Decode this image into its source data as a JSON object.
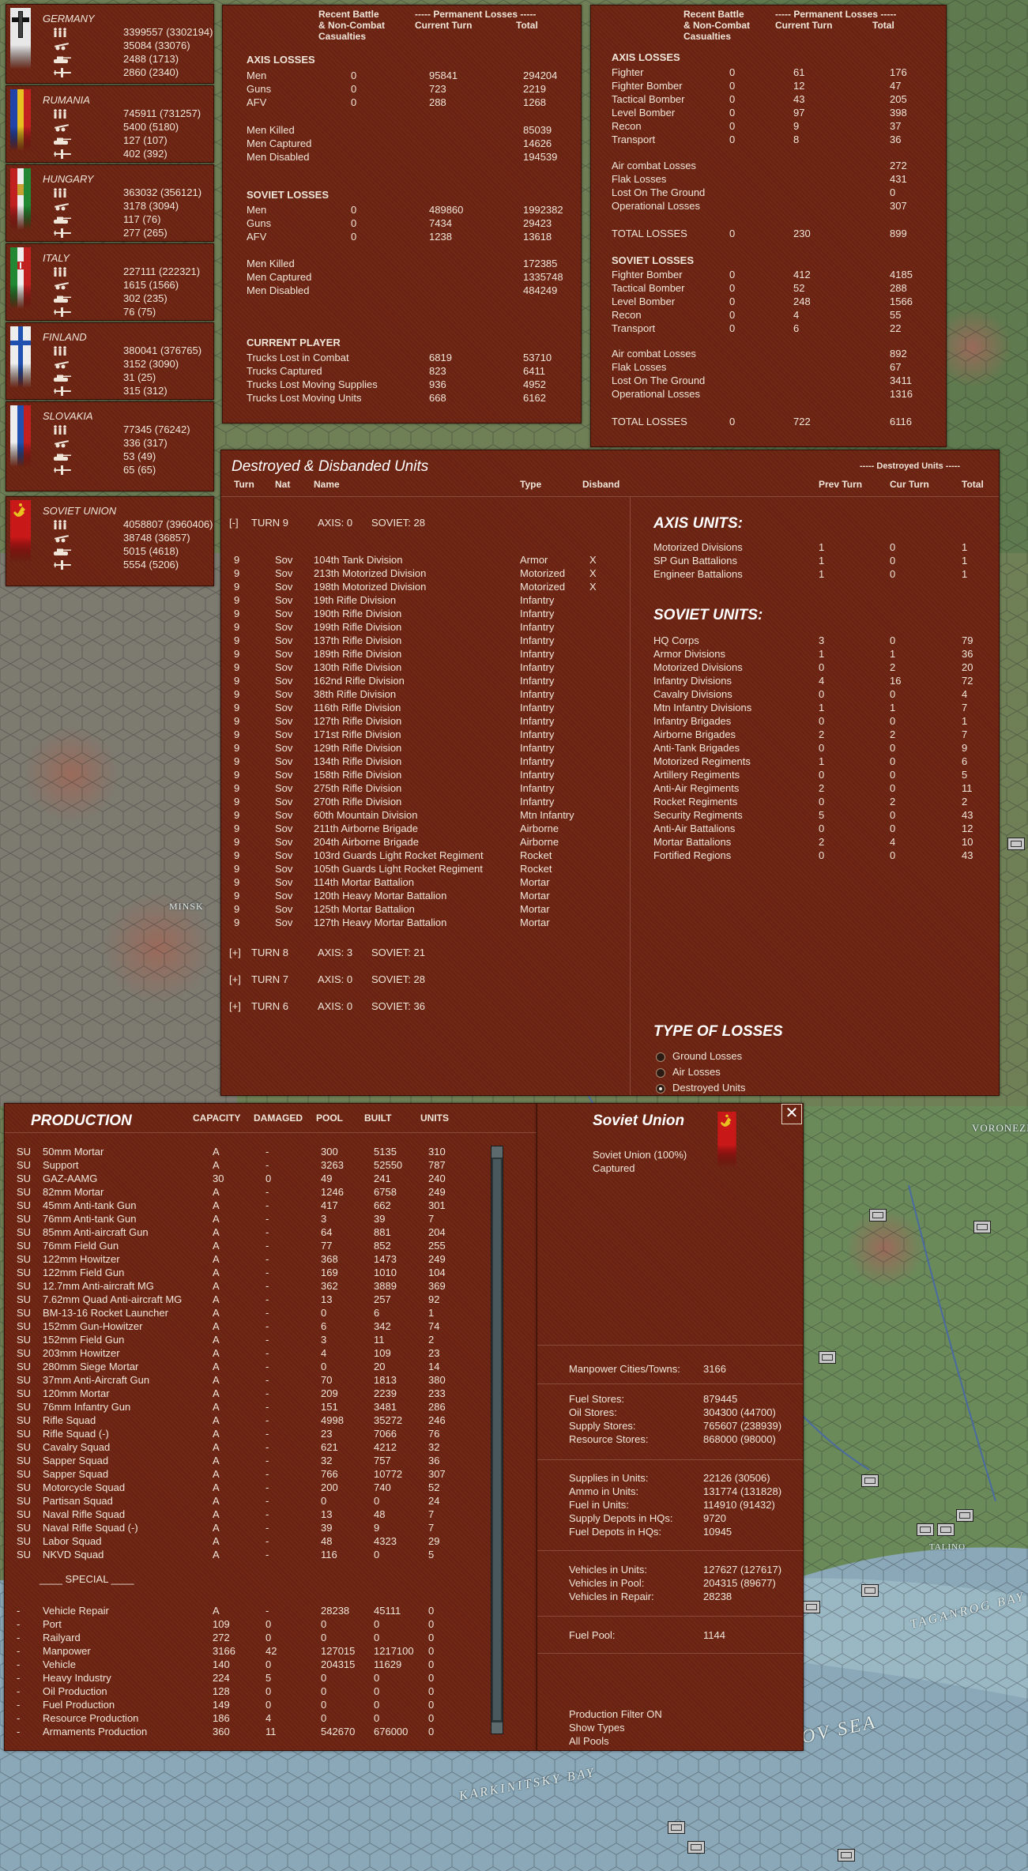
{
  "map": {
    "labels": [
      "VORONEZH",
      "MINSK",
      "TALINO",
      "TAGANROG BAY",
      "AZOV SEA",
      "KARKINITSKY BAY"
    ]
  },
  "nations": [
    {
      "name": "GERMANY",
      "values": [
        "3399557 (3302194)",
        "35084 (33076)",
        "2488 (1713)",
        "2860 (2340)"
      ],
      "flag": "germany"
    },
    {
      "name": "RUMANIA",
      "values": [
        "745911 (731257)",
        "5400 (5180)",
        "127 (107)",
        "402 (392)"
      ],
      "flag": "rumania"
    },
    {
      "name": "HUNGARY",
      "values": [
        "363032 (356121)",
        "3178 (3094)",
        "117 (76)",
        "277 (265)"
      ],
      "flag": "hungary"
    },
    {
      "name": "ITALY",
      "values": [
        "227111 (222321)",
        "1615 (1566)",
        "302 (235)",
        "76 (75)"
      ],
      "flag": "italy"
    },
    {
      "name": "FINLAND",
      "values": [
        "380041 (376765)",
        "3152 (3090)",
        "31 (25)",
        "315 (312)"
      ],
      "flag": "finland"
    },
    {
      "name": "SLOVAKIA",
      "values": [
        "77345 (76242)",
        "336 (317)",
        "53 (49)",
        "65 (65)"
      ],
      "flag": "slovakia"
    },
    {
      "name": "SOVIET UNION",
      "values": [
        "4058807 (3960406)",
        "38748 (36857)",
        "5015 (4618)",
        "5554 (5206)"
      ],
      "flag": "soviet"
    }
  ],
  "ground_losses": {
    "header": {
      "recent": "Recent Battle",
      "noncombat": "& Non-Combat",
      "casualties": "Casualties",
      "permanent": "----- Permanent Losses -----",
      "current_turn": "Current Turn",
      "total": "Total"
    },
    "axis_title": "AXIS LOSSES",
    "axis_rows": [
      [
        "Men",
        "0",
        "95841",
        "294204"
      ],
      [
        "Guns",
        "0",
        "723",
        "2219"
      ],
      [
        "AFV",
        "0",
        "288",
        "1268"
      ]
    ],
    "axis_men": [
      [
        "Men Killed",
        "85039"
      ],
      [
        "Men Captured",
        "14626"
      ],
      [
        "Men Disabled",
        "194539"
      ]
    ],
    "soviet_title": "SOVIET LOSSES",
    "soviet_rows": [
      [
        "Men",
        "0",
        "489860",
        "1992382"
      ],
      [
        "Guns",
        "0",
        "7434",
        "29423"
      ],
      [
        "AFV",
        "0",
        "1238",
        "13618"
      ]
    ],
    "soviet_men": [
      [
        "Men Killed",
        "172385"
      ],
      [
        "Men Captured",
        "1335748"
      ],
      [
        "Men Disabled",
        "484249"
      ]
    ],
    "player_title": "CURRENT PLAYER",
    "player_rows": [
      [
        "Trucks Lost in Combat",
        "6819",
        "53710"
      ],
      [
        "Trucks Captured",
        "823",
        "6411"
      ],
      [
        "Trucks Lost Moving Supplies",
        "936",
        "4952"
      ],
      [
        "Trucks Lost Moving Units",
        "668",
        "6162"
      ]
    ]
  },
  "air_losses": {
    "header": {
      "recent": "Recent Battle",
      "noncombat": "& Non-Combat",
      "casualties": "Casualties",
      "permanent": "----- Permanent Losses -----",
      "current_turn": "Current Turn",
      "total": "Total"
    },
    "axis_title": "AXIS LOSSES",
    "axis_rows": [
      [
        "Fighter",
        "0",
        "61",
        "176"
      ],
      [
        "Fighter Bomber",
        "0",
        "12",
        "47"
      ],
      [
        "Tactical Bomber",
        "0",
        "43",
        "205"
      ],
      [
        "Level Bomber",
        "0",
        "97",
        "398"
      ],
      [
        "Recon",
        "0",
        "9",
        "37"
      ],
      [
        "Transport",
        "0",
        "8",
        "36"
      ]
    ],
    "axis_cause": [
      [
        "Air combat Losses",
        "272"
      ],
      [
        "Flak Losses",
        "431"
      ],
      [
        "Lost On The Ground",
        "0"
      ],
      [
        "Operational Losses",
        "307"
      ]
    ],
    "axis_total": [
      "TOTAL LOSSES",
      "0",
      "230",
      "899"
    ],
    "soviet_title": "SOVIET LOSSES",
    "soviet_rows": [
      [
        "Fighter Bomber",
        "0",
        "412",
        "4185"
      ],
      [
        "Tactical Bomber",
        "0",
        "52",
        "288"
      ],
      [
        "Level Bomber",
        "0",
        "248",
        "1566"
      ],
      [
        "Recon",
        "0",
        "4",
        "55"
      ],
      [
        "Transport",
        "0",
        "6",
        "22"
      ]
    ],
    "soviet_cause": [
      [
        "Air combat Losses",
        "892"
      ],
      [
        "Flak Losses",
        "67"
      ],
      [
        "Lost On The Ground",
        "3411"
      ],
      [
        "Operational Losses",
        "1316"
      ]
    ],
    "soviet_total": [
      "TOTAL LOSSES",
      "0",
      "722",
      "6116"
    ]
  },
  "destroyed": {
    "title": "Destroyed & Disbanded Units",
    "destroyed_header": "----- Destroyed Units -----",
    "columns": {
      "turn": "Turn",
      "nat": "Nat",
      "name": "Name",
      "type": "Type",
      "disband": "Disband",
      "prev_turn": "Prev Turn",
      "cur_turn": "Cur Turn",
      "total": "Total"
    },
    "turns": [
      {
        "toggle": "[-]",
        "label": "TURN 9",
        "axis": "AXIS: 0",
        "soviet": "SOVIET: 28"
      },
      {
        "toggle": "[+]",
        "label": "TURN 8",
        "axis": "AXIS: 3",
        "soviet": "SOVIET: 21"
      },
      {
        "toggle": "[+]",
        "label": "TURN 7",
        "axis": "AXIS: 0",
        "soviet": "SOVIET: 28"
      },
      {
        "toggle": "[+]",
        "label": "TURN 6",
        "axis": "AXIS: 0",
        "soviet": "SOVIET: 36"
      }
    ],
    "units": [
      [
        "9",
        "Sov",
        "104th Tank Division",
        "Armor",
        "X"
      ],
      [
        "9",
        "Sov",
        "213th Motorized Division",
        "Motorized",
        "X"
      ],
      [
        "9",
        "Sov",
        "198th Motorized Division",
        "Motorized",
        "X"
      ],
      [
        "9",
        "Sov",
        "19th Rifle Division",
        "Infantry",
        ""
      ],
      [
        "9",
        "Sov",
        "190th Rifle Division",
        "Infantry",
        ""
      ],
      [
        "9",
        "Sov",
        "199th Rifle Division",
        "Infantry",
        ""
      ],
      [
        "9",
        "Sov",
        "137th Rifle Division",
        "Infantry",
        ""
      ],
      [
        "9",
        "Sov",
        "189th Rifle Division",
        "Infantry",
        ""
      ],
      [
        "9",
        "Sov",
        "130th Rifle Division",
        "Infantry",
        ""
      ],
      [
        "9",
        "Sov",
        "162nd Rifle Division",
        "Infantry",
        ""
      ],
      [
        "9",
        "Sov",
        "38th Rifle Division",
        "Infantry",
        ""
      ],
      [
        "9",
        "Sov",
        "116th Rifle Division",
        "Infantry",
        ""
      ],
      [
        "9",
        "Sov",
        "127th Rifle Division",
        "Infantry",
        ""
      ],
      [
        "9",
        "Sov",
        "171st Rifle Division",
        "Infantry",
        ""
      ],
      [
        "9",
        "Sov",
        "129th Rifle Division",
        "Infantry",
        ""
      ],
      [
        "9",
        "Sov",
        "134th Rifle Division",
        "Infantry",
        ""
      ],
      [
        "9",
        "Sov",
        "158th Rifle Division",
        "Infantry",
        ""
      ],
      [
        "9",
        "Sov",
        "275th Rifle Division",
        "Infantry",
        ""
      ],
      [
        "9",
        "Sov",
        "270th Rifle Division",
        "Infantry",
        ""
      ],
      [
        "9",
        "Sov",
        "60th Mountain Division",
        "Mtn Infantry",
        ""
      ],
      [
        "9",
        "Sov",
        "211th Airborne Brigade",
        "Airborne",
        ""
      ],
      [
        "9",
        "Sov",
        "204th Airborne Brigade",
        "Airborne",
        ""
      ],
      [
        "9",
        "Sov",
        "103rd Guards Light Rocket Regiment",
        "Rocket",
        ""
      ],
      [
        "9",
        "Sov",
        "105th Guards Light Rocket Regiment",
        "Rocket",
        ""
      ],
      [
        "9",
        "Sov",
        "114th Mortar Battalion",
        "Mortar",
        ""
      ],
      [
        "9",
        "Sov",
        "120th Heavy Mortar Battalion",
        "Mortar",
        ""
      ],
      [
        "9",
        "Sov",
        "125th Mortar Battalion",
        "Mortar",
        ""
      ],
      [
        "9",
        "Sov",
        "127th Heavy Mortar Battalion",
        "Mortar",
        ""
      ]
    ],
    "axis_units_title": "AXIS UNITS:",
    "axis_units": [
      [
        "Motorized Divisions",
        "1",
        "0",
        "1"
      ],
      [
        "SP Gun Battalions",
        "1",
        "0",
        "1"
      ],
      [
        "Engineer Battalions",
        "1",
        "0",
        "1"
      ]
    ],
    "soviet_units_title": "SOVIET UNITS:",
    "soviet_units": [
      [
        "HQ Corps",
        "3",
        "0",
        "79"
      ],
      [
        "Armor Divisions",
        "1",
        "1",
        "36"
      ],
      [
        "Motorized Divisions",
        "0",
        "2",
        "20"
      ],
      [
        "Infantry Divisions",
        "4",
        "16",
        "72"
      ],
      [
        "Cavalry Divisions",
        "0",
        "0",
        "4"
      ],
      [
        "Mtn Infantry Divisions",
        "1",
        "1",
        "7"
      ],
      [
        "Infantry Brigades",
        "0",
        "0",
        "1"
      ],
      [
        "Airborne Brigades",
        "2",
        "2",
        "7"
      ],
      [
        "Anti-Tank Brigades",
        "0",
        "0",
        "9"
      ],
      [
        "Motorized Regiments",
        "1",
        "0",
        "6"
      ],
      [
        "Artillery Regiments",
        "0",
        "0",
        "5"
      ],
      [
        "Anti-Air Regiments",
        "2",
        "0",
        "11"
      ],
      [
        "Rocket Regiments",
        "0",
        "2",
        "2"
      ],
      [
        "Security Regiments",
        "5",
        "0",
        "43"
      ],
      [
        "Anti-Air Battalions",
        "0",
        "0",
        "12"
      ],
      [
        "Mortar Battalions",
        "2",
        "4",
        "10"
      ],
      [
        "Fortified Regions",
        "0",
        "0",
        "43"
      ]
    ],
    "loss_types_title": "TYPE OF LOSSES",
    "loss_types": [
      "Ground Losses",
      "Air Losses",
      "Destroyed Units"
    ],
    "loss_type_selected": 2
  },
  "production": {
    "title": "PRODUCTION",
    "columns": {
      "capacity": "CAPACITY",
      "damaged": "DAMAGED",
      "pool": "POOL",
      "built": "BUILT",
      "units": "UNITS"
    },
    "rows": [
      [
        "SU",
        "50mm Mortar",
        "A",
        "-",
        "300",
        "5135",
        "310"
      ],
      [
        "SU",
        "Support",
        "A",
        "-",
        "3263",
        "52550",
        "787"
      ],
      [
        "SU",
        "GAZ-AAMG",
        "30",
        "0",
        "49",
        "241",
        "240"
      ],
      [
        "SU",
        "82mm Mortar",
        "A",
        "-",
        "1246",
        "6758",
        "249"
      ],
      [
        "SU",
        "45mm Anti-tank Gun",
        "A",
        "-",
        "417",
        "662",
        "301"
      ],
      [
        "SU",
        "76mm Anti-tank Gun",
        "A",
        "-",
        "3",
        "39",
        "7"
      ],
      [
        "SU",
        "85mm Anti-aircraft Gun",
        "A",
        "-",
        "64",
        "881",
        "204"
      ],
      [
        "SU",
        "76mm Field Gun",
        "A",
        "-",
        "77",
        "852",
        "255"
      ],
      [
        "SU",
        "122mm Howitzer",
        "A",
        "-",
        "368",
        "1473",
        "249"
      ],
      [
        "SU",
        "122mm Field Gun",
        "A",
        "-",
        "169",
        "1010",
        "104"
      ],
      [
        "SU",
        "12.7mm Anti-aircraft MG",
        "A",
        "-",
        "362",
        "3889",
        "369"
      ],
      [
        "SU",
        "7.62mm Quad Anti-aircraft MG",
        "A",
        "-",
        "13",
        "257",
        "92"
      ],
      [
        "SU",
        "BM-13-16 Rocket Launcher",
        "A",
        "-",
        "0",
        "6",
        "1"
      ],
      [
        "SU",
        "152mm Gun-Howitzer",
        "A",
        "-",
        "6",
        "342",
        "74"
      ],
      [
        "SU",
        "152mm Field Gun",
        "A",
        "-",
        "3",
        "11",
        "2"
      ],
      [
        "SU",
        "203mm Howitzer",
        "A",
        "-",
        "4",
        "109",
        "23"
      ],
      [
        "SU",
        "280mm Siege Mortar",
        "A",
        "-",
        "0",
        "20",
        "14"
      ],
      [
        "SU",
        "37mm Anti-Aircraft Gun",
        "A",
        "-",
        "70",
        "1813",
        "380"
      ],
      [
        "SU",
        "120mm Mortar",
        "A",
        "-",
        "209",
        "2239",
        "233"
      ],
      [
        "SU",
        "76mm Infantry Gun",
        "A",
        "-",
        "151",
        "3481",
        "286"
      ],
      [
        "SU",
        "Rifle Squad",
        "A",
        "-",
        "4998",
        "35272",
        "246"
      ],
      [
        "SU",
        "Rifle Squad (-)",
        "A",
        "-",
        "23",
        "7066",
        "76"
      ],
      [
        "SU",
        "Cavalry Squad",
        "A",
        "-",
        "621",
        "4212",
        "32"
      ],
      [
        "SU",
        "Sapper Squad",
        "A",
        "-",
        "32",
        "757",
        "36"
      ],
      [
        "SU",
        "Sapper Squad",
        "A",
        "-",
        "766",
        "10772",
        "307"
      ],
      [
        "SU",
        "Motorcycle Squad",
        "A",
        "-",
        "200",
        "740",
        "52"
      ],
      [
        "SU",
        "Partisan Squad",
        "A",
        "-",
        "0",
        "0",
        "24"
      ],
      [
        "SU",
        "Naval Rifle Squad",
        "A",
        "-",
        "13",
        "48",
        "7"
      ],
      [
        "SU",
        "Naval Rifle Squad (-)",
        "A",
        "-",
        "39",
        "9",
        "7"
      ],
      [
        "SU",
        "Labor Squad",
        "A",
        "-",
        "48",
        "4323",
        "29"
      ],
      [
        "SU",
        "NKVD Squad",
        "A",
        "-",
        "116",
        "0",
        "5"
      ]
    ],
    "special_title": "____ SPECIAL ____",
    "special_rows": [
      [
        "-",
        "Vehicle Repair",
        "A",
        "-",
        "28238",
        "45111",
        "0"
      ],
      [
        "-",
        "Port",
        "109",
        "0",
        "0",
        "0",
        "0"
      ],
      [
        "-",
        "Railyard",
        "272",
        "0",
        "0",
        "0",
        "0"
      ],
      [
        "-",
        "Manpower",
        "3166",
        "42",
        "127015",
        "1217100",
        "0"
      ],
      [
        "-",
        "Vehicle",
        "140",
        "0",
        "204315",
        "11629",
        "0"
      ],
      [
        "-",
        "Heavy Industry",
        "224",
        "5",
        "0",
        "0",
        "0"
      ],
      [
        "-",
        "Oil Production",
        "128",
        "0",
        "0",
        "0",
        "0"
      ],
      [
        "-",
        "Fuel Production",
        "149",
        "0",
        "0",
        "0",
        "0"
      ],
      [
        "-",
        "Resource Production",
        "186",
        "4",
        "0",
        "0",
        "0"
      ],
      [
        "-",
        "Armaments Production",
        "360",
        "11",
        "542670",
        "676000",
        "0"
      ]
    ]
  },
  "soviet_info": {
    "title": "Soviet Union",
    "ownership": "Soviet Union  (100%)",
    "captured": "Captured",
    "close": "✕",
    "manpower": [
      [
        "Manpower Cities/Towns:",
        "3166"
      ]
    ],
    "stores": [
      [
        "Fuel Stores:",
        "879445"
      ],
      [
        "Oil Stores:",
        "304300 (44700)"
      ],
      [
        "Supply Stores:",
        "765607 (238939)"
      ],
      [
        "Resource Stores:",
        "868000 (98000)"
      ]
    ],
    "units_supply": [
      [
        "Supplies in Units:",
        "22126 (30506)"
      ],
      [
        "Ammo in Units:",
        "131774 (131828)"
      ],
      [
        "Fuel in Units:",
        "114910 (91432)"
      ],
      [
        "Supply Depots in HQs:",
        "9720"
      ],
      [
        "Fuel Depots in HQs:",
        "10945"
      ]
    ],
    "vehicles": [
      [
        "Vehicles in Units:",
        "127627 (127617)"
      ],
      [
        "Vehicles in Pool:",
        "204315 (89677)"
      ],
      [
        "Vehicles in Repair:",
        "28238"
      ]
    ],
    "fuel_pool": [
      [
        "Fuel Pool:",
        "1144"
      ]
    ],
    "filters": [
      "Production Filter ON",
      "Show Types",
      "All Pools"
    ]
  }
}
